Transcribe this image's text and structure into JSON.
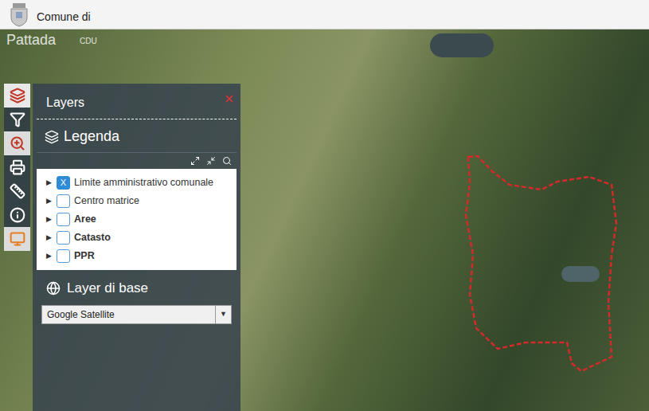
{
  "header": {
    "title": "Comune di",
    "name": "Pattada",
    "app": "CDU"
  },
  "toolbar": [
    {
      "active": true
    },
    {
      "active": false
    },
    {
      "active": true
    },
    {
      "active": false
    },
    {
      "active": false
    },
    {
      "active": false
    },
    {
      "active": true
    }
  ],
  "panel": {
    "title": "Layers",
    "legend_title": "Legenda",
    "layers": [
      {
        "label": "Limite amministrativo comunale",
        "arrow": "▶",
        "checked": true,
        "mark": "X",
        "bold": false
      },
      {
        "label": "Centro matrice",
        "arrow": "▶",
        "checked": false,
        "mark": "",
        "bold": false
      },
      {
        "label": "Aree",
        "arrow": "▶",
        "checked": false,
        "mark": "",
        "bold": true
      },
      {
        "label": "Catasto",
        "arrow": "▶",
        "checked": false,
        "mark": "",
        "bold": true
      },
      {
        "label": "PPR",
        "arrow": "▶",
        "checked": false,
        "mark": "",
        "bold": true
      }
    ],
    "base_title": "Layer di base",
    "base_select": {
      "value": "Google Satellite",
      "arrow": "▼"
    }
  }
}
